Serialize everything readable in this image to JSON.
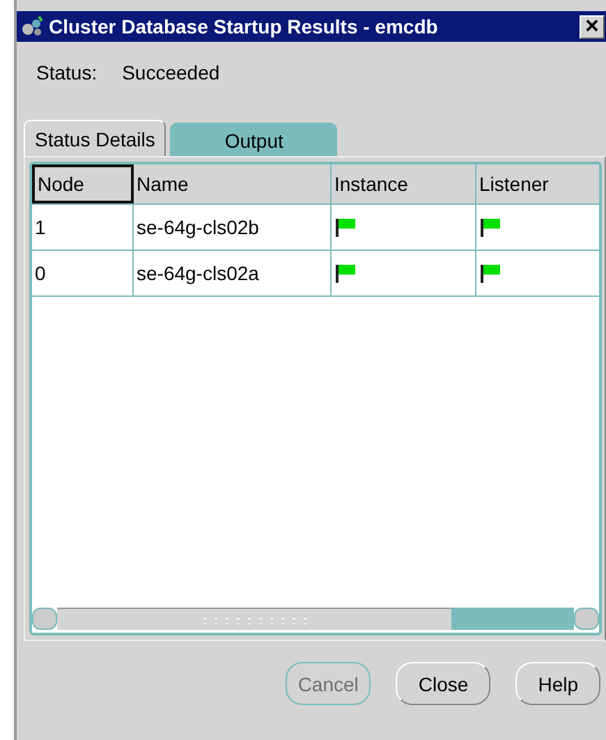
{
  "window": {
    "title": "Cluster Database Startup Results - emcdb",
    "close": "×"
  },
  "status": {
    "label": "Status:",
    "value": "Succeeded"
  },
  "tabs": [
    {
      "label": "Status Details",
      "selected": true
    },
    {
      "label": "Output",
      "selected": false
    }
  ],
  "table": {
    "columns": [
      "Node",
      "Name",
      "Instance",
      "Listener"
    ],
    "rows": [
      {
        "node": "1",
        "name": "se-64g-cls02b",
        "instance_ok": true,
        "listener_ok": true
      },
      {
        "node": "0",
        "name": "se-64g-cls02a",
        "instance_ok": true,
        "listener_ok": true
      }
    ]
  },
  "buttons": [
    {
      "label": "Cancel",
      "disabled": true
    },
    {
      "label": "Close",
      "disabled": false
    },
    {
      "label": "Help",
      "disabled": false
    }
  ]
}
